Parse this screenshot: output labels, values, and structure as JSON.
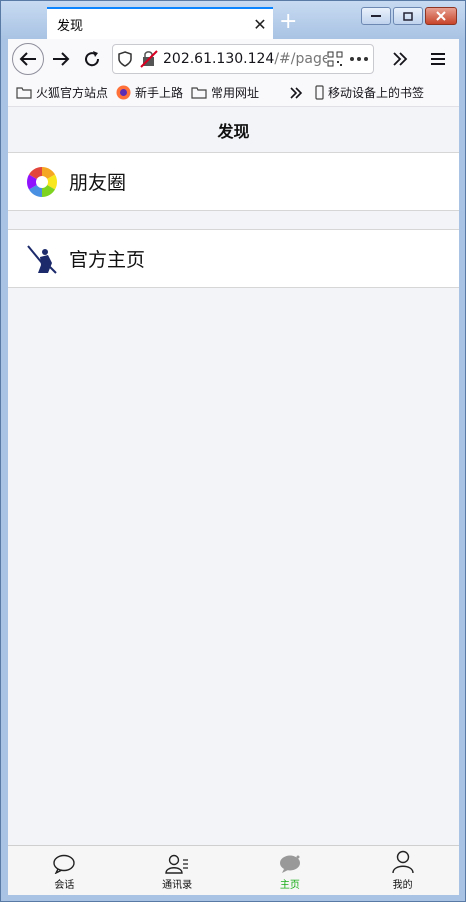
{
  "browser": {
    "tab_title": "发现",
    "url_host": "202.61.130.124",
    "url_path": "/#/page"
  },
  "bookmarks": [
    {
      "label": "火狐官方站点",
      "icon": "folder-icon"
    },
    {
      "label": "新手上路",
      "icon": "firefox-icon"
    },
    {
      "label": "常用网址",
      "icon": "folder-icon"
    },
    {
      "label": "移动设备上的书签",
      "icon": "mobile-icon"
    }
  ],
  "app": {
    "header_title": "发现",
    "items": [
      {
        "label": "朋友圈",
        "icon": "moments-icon"
      },
      {
        "label": "官方主页",
        "icon": "official-home-icon"
      }
    ],
    "tabbar": [
      {
        "label": "会话",
        "icon": "chat-bubble-icon"
      },
      {
        "label": "通讯录",
        "icon": "contacts-icon"
      },
      {
        "label": "主页",
        "icon": "home-bubble-icon",
        "active": true
      },
      {
        "label": "我的",
        "icon": "person-icon"
      }
    ],
    "colors": {
      "active": "#1aad19",
      "background": "#f3f4f7"
    }
  }
}
